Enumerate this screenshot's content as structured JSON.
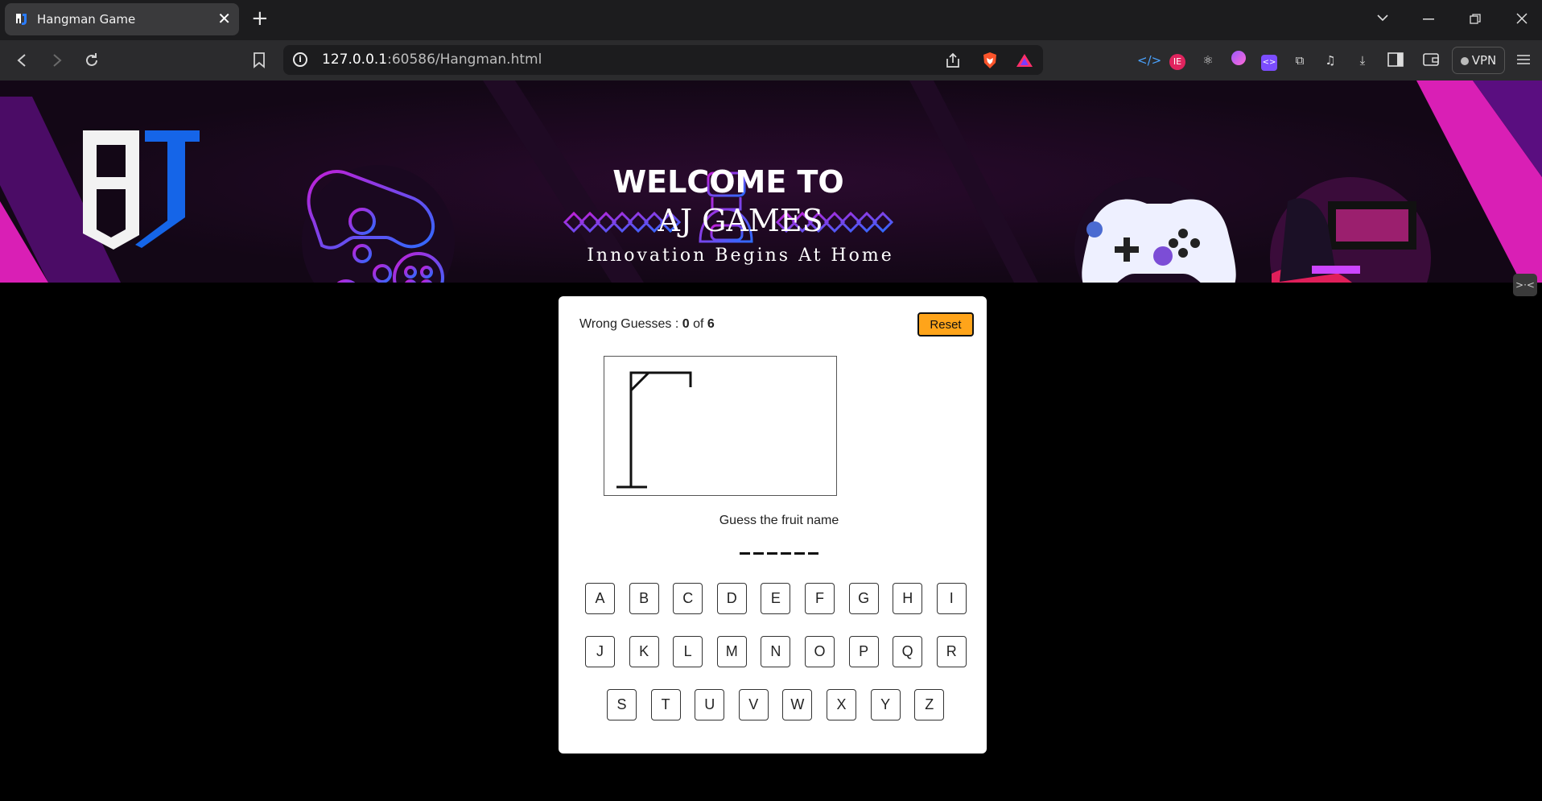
{
  "browser": {
    "tab_title": "Hangman Game",
    "tab_close": "✕",
    "new_tab": "+",
    "url_host": "127.0.0.1",
    "url_path": ":60586/Hangman.html",
    "vpn_label": "VPN"
  },
  "banner": {
    "welcome": "WELCOME TO",
    "brand": "AJ GAMES",
    "tagline": "Innovation Begins At Home",
    "logo_text": "AJ"
  },
  "game": {
    "wrong_label": "Wrong Guesses :",
    "wrong_count": "0",
    "wrong_of": "of",
    "wrong_max": "6",
    "reset_label": "Reset",
    "hint": "Guess the fruit name",
    "word_length": 6,
    "keys_row1": [
      "A",
      "B",
      "C",
      "D",
      "E",
      "F",
      "G",
      "H",
      "I"
    ],
    "keys_row2": [
      "J",
      "K",
      "L",
      "M",
      "N",
      "O",
      "P",
      "Q",
      "R"
    ],
    "keys_row3": [
      "S",
      "T",
      "U",
      "V",
      "W",
      "X",
      "Y",
      "Z"
    ]
  },
  "colors": {
    "reset_bg": "#ffa41a",
    "banner_bg": "#130716",
    "accent_magenta": "#d91fb5"
  }
}
